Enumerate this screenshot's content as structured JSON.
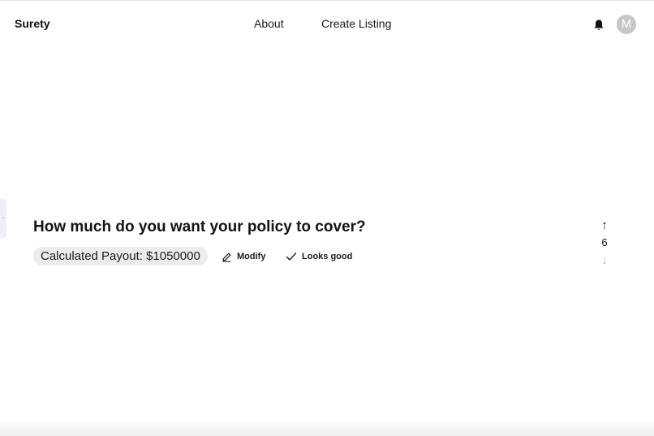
{
  "header": {
    "brand": "Surety",
    "nav": {
      "about": "About",
      "create_listing": "Create Listing"
    },
    "bell_icon": "bell-icon",
    "avatar_initial": "M"
  },
  "question": {
    "title": "How much do you want your policy to cover?",
    "payout_label": "Calculated Payout: $1050000",
    "actions": {
      "modify": "Modify",
      "looks_good": "Looks good"
    },
    "modify_icon": "pencil-icon",
    "looks_good_icon": "check-icon"
  },
  "stepper": {
    "up": "↑",
    "value": "6",
    "down": "↓"
  }
}
